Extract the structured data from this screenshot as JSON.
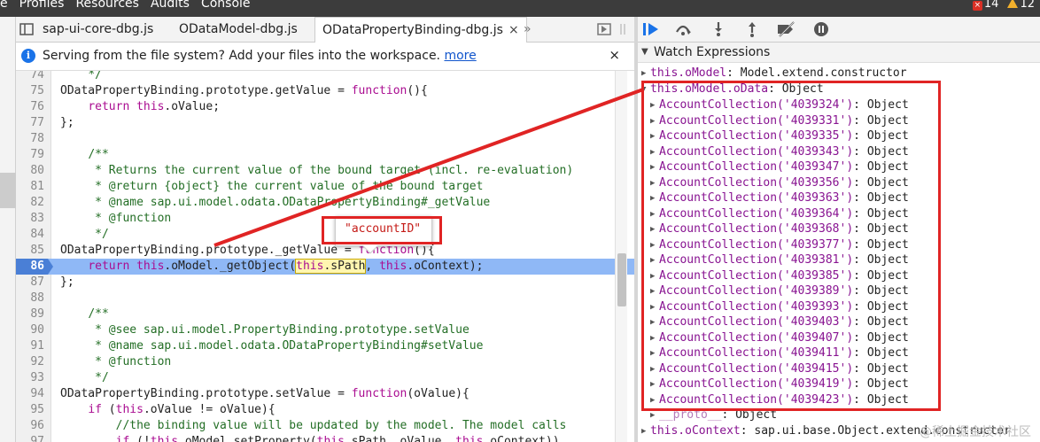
{
  "topbar": {
    "menu": [
      "e",
      "Profiles",
      "Resources",
      "Audits",
      "Console"
    ],
    "errors": "14",
    "warnings": "12"
  },
  "tabs": {
    "files": [
      "sap-ui-core-dbg.js",
      "ODataModel-dbg.js",
      "ODataPropertyBinding-dbg.js"
    ],
    "close": "×",
    "more": "»"
  },
  "notice": {
    "text": "Serving from the file system? Add your files into the workspace.",
    "link": "more",
    "close": "×"
  },
  "editor": {
    "lines": [
      {
        "n": "74",
        "html": "    <span class=\"cm\">*/</span>"
      },
      {
        "n": "75",
        "html": "ODataPropertyBinding.prototype.getValue = <span class=\"kw\">function</span>(){"
      },
      {
        "n": "76",
        "html": "    <span class=\"kw\">return this</span>.oValue;"
      },
      {
        "n": "77",
        "html": "};"
      },
      {
        "n": "78",
        "html": ""
      },
      {
        "n": "79",
        "html": "    <span class=\"cm\">/**</span>"
      },
      {
        "n": "80",
        "html": "    <span class=\"cm\"> * Returns the current value of the bound target (incl. re-evaluation)</span>"
      },
      {
        "n": "81",
        "html": "    <span class=\"cm\"> * @return {object} the current value of the bound target</span>"
      },
      {
        "n": "82",
        "html": "    <span class=\"cm\"> * @name sap.ui.model.odata.ODataPropertyBinding#_getValue</span>"
      },
      {
        "n": "83",
        "html": "    <span class=\"cm\"> * @function</span>"
      },
      {
        "n": "84",
        "html": "    <span class=\"cm\"> */</span>"
      },
      {
        "n": "85",
        "html": "ODataPropertyBinding.prototype._getValue = <span class=\"kw\">function</span>(){"
      },
      {
        "n": "86",
        "html": "    <span class=\"kw\">return this</span>.oModel._getObject(<span class=\"tok\"><span class=\"kw\">this</span>.sPath</span>, <span class=\"kw\">this</span>.oContext);",
        "hl": true
      },
      {
        "n": "87",
        "html": "};"
      },
      {
        "n": "88",
        "html": ""
      },
      {
        "n": "89",
        "html": "    <span class=\"cm\">/**</span>"
      },
      {
        "n": "90",
        "html": "    <span class=\"cm\"> * @see sap.ui.model.PropertyBinding.prototype.setValue</span>"
      },
      {
        "n": "91",
        "html": "    <span class=\"cm\"> * @name sap.ui.model.odata.ODataPropertyBinding#setValue</span>"
      },
      {
        "n": "92",
        "html": "    <span class=\"cm\"> * @function</span>"
      },
      {
        "n": "93",
        "html": "    <span class=\"cm\"> */</span>"
      },
      {
        "n": "94",
        "html": "ODataPropertyBinding.prototype.setValue = <span class=\"kw\">function</span>(oValue){"
      },
      {
        "n": "95",
        "html": "    <span class=\"kw\">if</span> (<span class=\"kw\">this</span>.oValue != oValue){"
      },
      {
        "n": "96",
        "html": "        <span class=\"cm\">//the binding value will be updated by the model. The model calls</span>"
      },
      {
        "n": "97",
        "html": "        <span class=\"kw\">if</span> (!<span class=\"kw\">this</span>.oModel.setProperty(<span class=\"kw\">this</span>.sPath, oValue, <span class=\"kw\">this</span>.oContext))"
      }
    ]
  },
  "tooltip": {
    "value": "\"accountID\""
  },
  "watch": {
    "title": "Watch Expressions",
    "top": {
      "key": "this.oModel",
      "value": "Model.extend.constructor"
    },
    "expanded": {
      "key": "this.oModel.oData",
      "value": "Object"
    },
    "items": [
      "4039324",
      "4039331",
      "4039335",
      "4039343",
      "4039347",
      "4039356",
      "4039363",
      "4039364",
      "4039368",
      "4039377",
      "4039381",
      "4039385",
      "4039389",
      "4039393",
      "4039403",
      "4039407",
      "4039411",
      "4039415",
      "4039419",
      "4039423"
    ],
    "item_prefix": "AccountCollection('",
    "item_suffix": "')",
    "item_value": "Object",
    "proto": {
      "key": "__proto__",
      "value": "Object"
    },
    "bottom": {
      "key": "this.oContext",
      "value": "sap.ui.base.Object.extend.constructor"
    }
  },
  "watermark": "@稀土掘金技术社区",
  "colors": {
    "annotation": "#e02424",
    "highlight": "#8fb8f6"
  }
}
